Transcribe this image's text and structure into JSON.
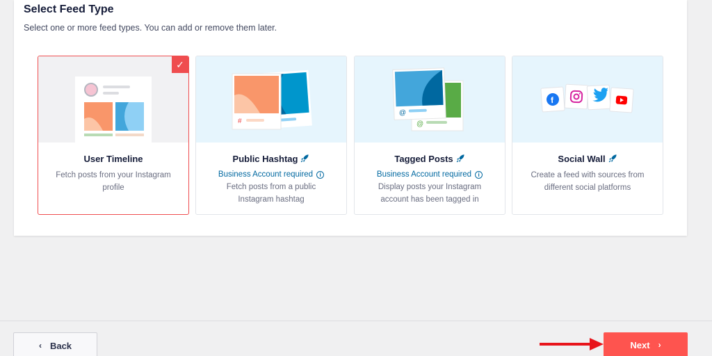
{
  "header": {
    "title": "Select Feed Type",
    "subtitle": "Select one or more feed types. You can add or remove them later."
  },
  "cards": [
    {
      "name": "User Timeline",
      "requirement": "",
      "description": "Fetch posts from your Instagram profile",
      "selected": true,
      "icon": "profile-timeline-illustration"
    },
    {
      "name": "Public Hashtag",
      "requirement": "Business Account required",
      "description": "Fetch posts from a public Instagram hashtag",
      "selected": false,
      "icon": "hashtag-illustration"
    },
    {
      "name": "Tagged Posts",
      "requirement": "Business Account required",
      "description": "Display posts your Instagram account has been tagged in",
      "selected": false,
      "icon": "tagged-posts-illustration"
    },
    {
      "name": "Social Wall",
      "requirement": "",
      "description": "Create a feed with sources from different social platforms",
      "selected": false,
      "icon": "social-wall-illustration"
    }
  ],
  "footer": {
    "back_label": "Back",
    "next_label": "Next"
  },
  "colors": {
    "accent": "#fe544f",
    "link": "#0068a0",
    "selected_border": "#ef4d4f",
    "annotation_arrow": "#e8141b"
  }
}
